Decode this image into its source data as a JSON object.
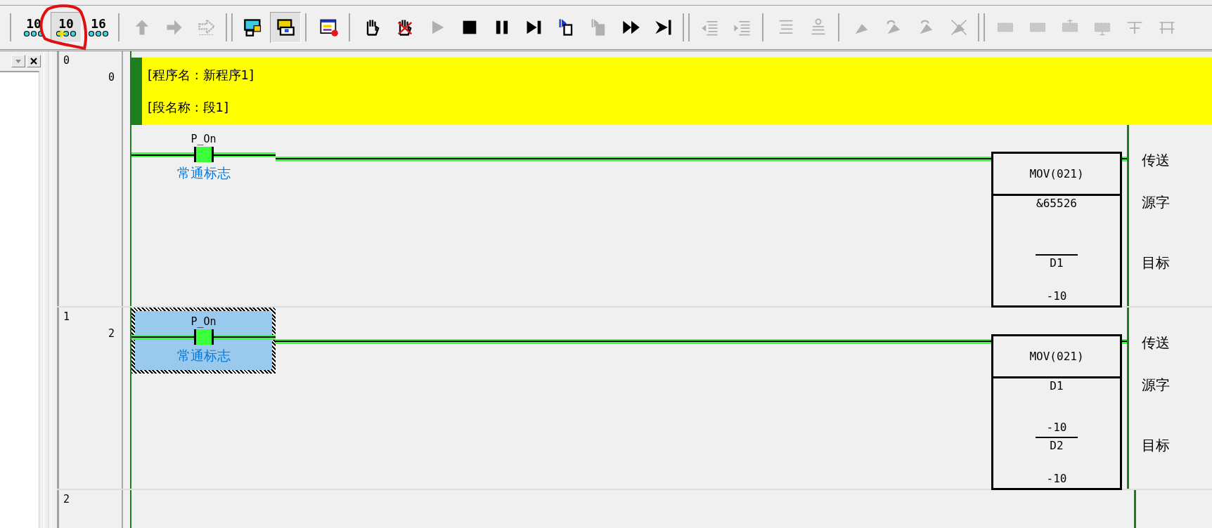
{
  "toolbar": [
    {
      "kind": "single",
      "items": [
        {
          "kind": "digits",
          "label": "10",
          "pressed": false,
          "disabled": false,
          "circled": false
        },
        {
          "kind": "digits-add",
          "label": "10",
          "pressed": true,
          "disabled": false,
          "circled": true
        },
        {
          "kind": "digits",
          "label": "16",
          "pressed": false,
          "disabled": false,
          "circled": false
        }
      ]
    },
    {
      "kind": "single",
      "items": [
        {
          "kind": "jump-up",
          "pressed": false,
          "disabled": true,
          "circled": false
        },
        {
          "kind": "jump-right",
          "pressed": false,
          "disabled": true,
          "circled": false
        },
        {
          "kind": "jump-pattern",
          "pressed": false,
          "disabled": true,
          "circled": false
        }
      ]
    },
    {
      "kind": "double",
      "items": [
        {
          "kind": "monitor-lock",
          "pressed": false,
          "disabled": false,
          "circled": false
        },
        {
          "kind": "monitor",
          "pressed": true,
          "disabled": false,
          "circled": false
        }
      ]
    },
    {
      "kind": "single",
      "items": [
        {
          "kind": "window-list",
          "pressed": false,
          "disabled": false,
          "circled": false
        }
      ]
    },
    {
      "kind": "single",
      "items": [
        {
          "kind": "hand",
          "pressed": false,
          "disabled": false,
          "circled": false
        },
        {
          "kind": "hand-cross",
          "pressed": false,
          "disabled": false,
          "circled": false
        },
        {
          "kind": "play",
          "pressed": false,
          "disabled": true,
          "circled": false
        },
        {
          "kind": "stop",
          "pressed": false,
          "disabled": false,
          "circled": false
        },
        {
          "kind": "pause",
          "pressed": false,
          "disabled": false,
          "circled": false
        },
        {
          "kind": "step",
          "pressed": false,
          "disabled": false,
          "circled": false
        },
        {
          "kind": "step-in",
          "pressed": false,
          "disabled": false,
          "circled": false
        },
        {
          "kind": "step-out",
          "pressed": false,
          "disabled": true,
          "circled": false
        },
        {
          "kind": "fast-forward",
          "pressed": false,
          "disabled": false,
          "circled": false
        },
        {
          "kind": "skip-end",
          "pressed": false,
          "disabled": false,
          "circled": false
        }
      ]
    },
    {
      "kind": "double",
      "items": [
        {
          "kind": "indent-left",
          "pressed": false,
          "disabled": true,
          "circled": false
        },
        {
          "kind": "indent-right",
          "pressed": false,
          "disabled": true,
          "circled": false
        }
      ]
    },
    {
      "kind": "single",
      "items": [
        {
          "kind": "lines",
          "pressed": false,
          "disabled": true,
          "circled": false
        },
        {
          "kind": "lines-round",
          "pressed": false,
          "disabled": true,
          "circled": false
        }
      ]
    },
    {
      "kind": "single",
      "items": [
        {
          "kind": "pen",
          "pressed": false,
          "disabled": true,
          "circled": false
        },
        {
          "kind": "pen-undo",
          "pressed": false,
          "disabled": true,
          "circled": false
        },
        {
          "kind": "pen-redo",
          "pressed": false,
          "disabled": true,
          "circled": false
        },
        {
          "kind": "pen-cross",
          "pressed": false,
          "disabled": true,
          "circled": false
        }
      ]
    },
    {
      "kind": "double",
      "items": [
        {
          "kind": "block",
          "pressed": false,
          "disabled": true,
          "circled": false
        },
        {
          "kind": "block",
          "pressed": false,
          "disabled": true,
          "circled": false
        },
        {
          "kind": "block-down",
          "pressed": false,
          "disabled": true,
          "circled": false
        },
        {
          "kind": "block-up",
          "pressed": false,
          "disabled": true,
          "circled": false
        },
        {
          "kind": "cross-line",
          "pressed": false,
          "disabled": true,
          "circled": false
        },
        {
          "kind": "cross-lines",
          "pressed": false,
          "disabled": true,
          "circled": false
        }
      ]
    }
  ],
  "rungs": [
    {
      "number": "0",
      "step": "0",
      "comments": [
        "[程序名 : 新程序1]",
        "[段名称 : 段1]"
      ],
      "contact": {
        "symbol": "P_On",
        "comment": "常通标志",
        "selected": false
      },
      "instruction": {
        "mnemonic": "MOV(021)",
        "label": "传送",
        "operands": [
          {
            "operand": "&65526",
            "label": "源字"
          },
          {
            "operand": "D1",
            "value": "-10",
            "label": "目标"
          }
        ]
      }
    },
    {
      "number": "1",
      "step": "2",
      "contact": {
        "symbol": "P_On",
        "comment": "常通标志",
        "selected": true
      },
      "instruction": {
        "mnemonic": "MOV(021)",
        "label": "传送",
        "operands": [
          {
            "operand": "D1",
            "value": "-10",
            "label": "源字"
          },
          {
            "operand": "D2",
            "value": "-10",
            "label": "目标"
          }
        ]
      }
    },
    {
      "number": "2"
    }
  ]
}
